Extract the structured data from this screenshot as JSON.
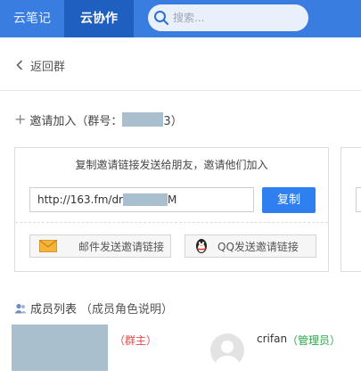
{
  "header": {
    "tabs": [
      {
        "label": "云笔记",
        "active": false
      },
      {
        "label": "云协作",
        "active": true
      }
    ],
    "search": {
      "placeholder": "搜索..."
    },
    "accent": "#3a7de0"
  },
  "nav": {
    "back_label": "返回群"
  },
  "invite": {
    "label_prefix": "邀请加入（群号：",
    "label_suffix": "3）",
    "title": "复制邀请链接发送给朋友，邀请他们加入",
    "link_prefix": "http://163.fm/dr",
    "link_suffix": "M",
    "copy_label": "复制",
    "mail_label": "邮件发送邀请链接",
    "qq_label": "QQ发送邀请链接"
  },
  "members": {
    "title": "成员列表",
    "role_note": "（成员角色说明）",
    "list": [
      {
        "name": "",
        "role": "（群主）",
        "role_color": "#e04848"
      },
      {
        "name": "crifan",
        "role": "（管理员）",
        "role_color": "#2aa84a"
      }
    ]
  }
}
